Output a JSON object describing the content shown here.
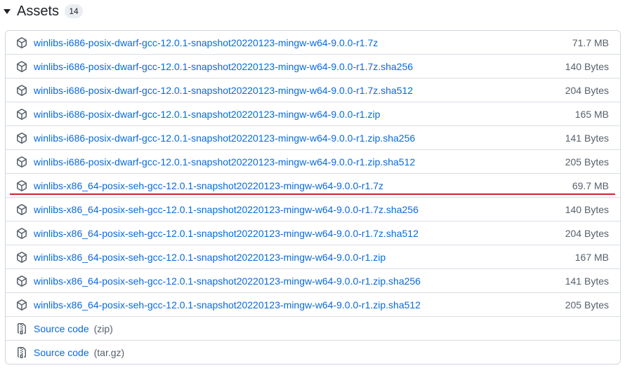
{
  "header": {
    "title": "Assets",
    "count": "14"
  },
  "assets": [
    {
      "name": "winlibs-i686-posix-dwarf-gcc-12.0.1-snapshot20220123-mingw-w64-9.0.0-r1.7z",
      "size": "71.7 MB"
    },
    {
      "name": "winlibs-i686-posix-dwarf-gcc-12.0.1-snapshot20220123-mingw-w64-9.0.0-r1.7z.sha256",
      "size": "140 Bytes"
    },
    {
      "name": "winlibs-i686-posix-dwarf-gcc-12.0.1-snapshot20220123-mingw-w64-9.0.0-r1.7z.sha512",
      "size": "204 Bytes"
    },
    {
      "name": "winlibs-i686-posix-dwarf-gcc-12.0.1-snapshot20220123-mingw-w64-9.0.0-r1.zip",
      "size": "165 MB"
    },
    {
      "name": "winlibs-i686-posix-dwarf-gcc-12.0.1-snapshot20220123-mingw-w64-9.0.0-r1.zip.sha256",
      "size": "141 Bytes"
    },
    {
      "name": "winlibs-i686-posix-dwarf-gcc-12.0.1-snapshot20220123-mingw-w64-9.0.0-r1.zip.sha512",
      "size": "205 Bytes"
    },
    {
      "name": "winlibs-x86_64-posix-seh-gcc-12.0.1-snapshot20220123-mingw-w64-9.0.0-r1.7z",
      "size": "69.7 MB"
    },
    {
      "name": "winlibs-x86_64-posix-seh-gcc-12.0.1-snapshot20220123-mingw-w64-9.0.0-r1.7z.sha256",
      "size": "140 Bytes"
    },
    {
      "name": "winlibs-x86_64-posix-seh-gcc-12.0.1-snapshot20220123-mingw-w64-9.0.0-r1.7z.sha512",
      "size": "204 Bytes"
    },
    {
      "name": "winlibs-x86_64-posix-seh-gcc-12.0.1-snapshot20220123-mingw-w64-9.0.0-r1.zip",
      "size": "167 MB"
    },
    {
      "name": "winlibs-x86_64-posix-seh-gcc-12.0.1-snapshot20220123-mingw-w64-9.0.0-r1.zip.sha256",
      "size": "141 Bytes"
    },
    {
      "name": "winlibs-x86_64-posix-seh-gcc-12.0.1-snapshot20220123-mingw-w64-9.0.0-r1.zip.sha512",
      "size": "205 Bytes"
    }
  ],
  "source_code": [
    {
      "label": "Source code",
      "format": "(zip)"
    },
    {
      "label": "Source code",
      "format": "(tar.gz)"
    }
  ],
  "icons": {
    "asset": "package-icon",
    "source": "file-zip-icon"
  },
  "colors": {
    "link": "#0969da",
    "muted": "#57606a",
    "highlight_underline": "#d1242f"
  }
}
